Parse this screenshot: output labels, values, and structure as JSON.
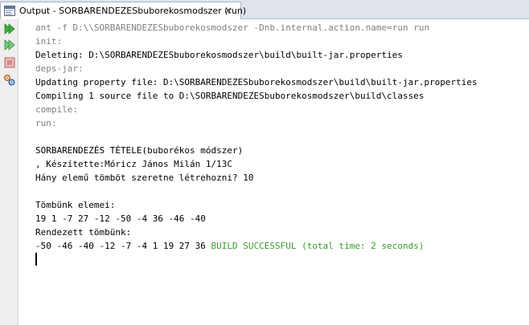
{
  "tab": {
    "icon": "output-window-icon",
    "title": "Output - SORBARENDEZESbuborekosmodszer (run)",
    "close_label": "×"
  },
  "toolbar": {
    "buttons": [
      {
        "icon": "rerun-icon",
        "color": "#2e9e2e"
      },
      {
        "icon": "rerun-with-options-icon",
        "color": "#2e9e2e"
      },
      {
        "icon": "stop-icon",
        "color": "#c96a6a"
      },
      {
        "icon": "settings-icon",
        "color": "#3b6fb6"
      }
    ]
  },
  "console": {
    "lines": [
      {
        "text": "ant -f D:\\\\SORBARENDEZESbuborekosmodszer -Dnb.internal.action.name=run run",
        "style": "gray"
      },
      {
        "text": "init:",
        "style": "gray"
      },
      {
        "text": "Deleting: D:\\SORBARENDEZESbuborekosmodszer\\build\\built-jar.properties",
        "style": "black"
      },
      {
        "text": "deps-jar:",
        "style": "gray"
      },
      {
        "text": "Updating property file: D:\\SORBARENDEZESbuborekosmodszer\\build\\built-jar.properties",
        "style": "black"
      },
      {
        "text": "Compiling 1 source file to D:\\SORBARENDEZESbuborekosmodszer\\build\\classes",
        "style": "black"
      },
      {
        "text": "compile:",
        "style": "gray"
      },
      {
        "text": "run:",
        "style": "gray"
      },
      {
        "text": "",
        "style": "black"
      },
      {
        "text": "SORBARENDEZÉS TÉTELE(buborékos módszer)",
        "style": "black"
      },
      {
        "text": ", Készítette:Móricz János Milán 1/13C",
        "style": "black"
      },
      {
        "text": "Hány elemű tömböt szeretne létrehozni? 10",
        "style": "black"
      },
      {
        "text": "",
        "style": "black"
      },
      {
        "text": "Tömbünk elemei:",
        "style": "black"
      },
      {
        "text": "19 1 -7 27 -12 -50 -4 36 -46 -40",
        "style": "black"
      },
      {
        "text": "Rendezett tömbünk:",
        "style": "black"
      }
    ],
    "last_line": {
      "output": "-50 -46 -40 -12 -7 -4 1 19 27 36 ",
      "build_status": "BUILD SUCCESSFUL (total time: 2 seconds)"
    }
  }
}
